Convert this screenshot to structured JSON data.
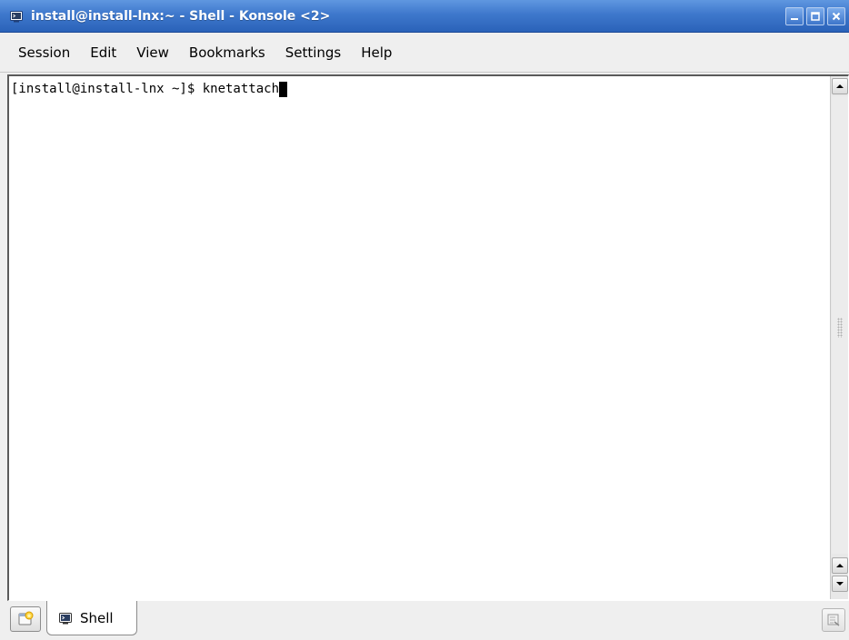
{
  "window": {
    "title": "install@install-lnx:~ - Shell - Konsole <2>",
    "app_icon": "konsole-icon",
    "controls": [
      "minimize-icon",
      "maximize-icon",
      "close-icon"
    ]
  },
  "menubar": {
    "items": [
      "Session",
      "Edit",
      "View",
      "Bookmarks",
      "Settings",
      "Help"
    ]
  },
  "terminal": {
    "prompt": "[install@install-lnx ~]$ ",
    "command": "knetattach"
  },
  "tabbar": {
    "new_tab_icon": "new-session-icon",
    "tabs": [
      {
        "label": "Shell",
        "icon": "konsole-icon"
      }
    ],
    "close_icon": "close-session-icon"
  },
  "colors": {
    "titlebar": "#3e78cc",
    "title_text": "#ffffff",
    "terminal_bg": "#ffffff",
    "terminal_fg": "#000000"
  }
}
